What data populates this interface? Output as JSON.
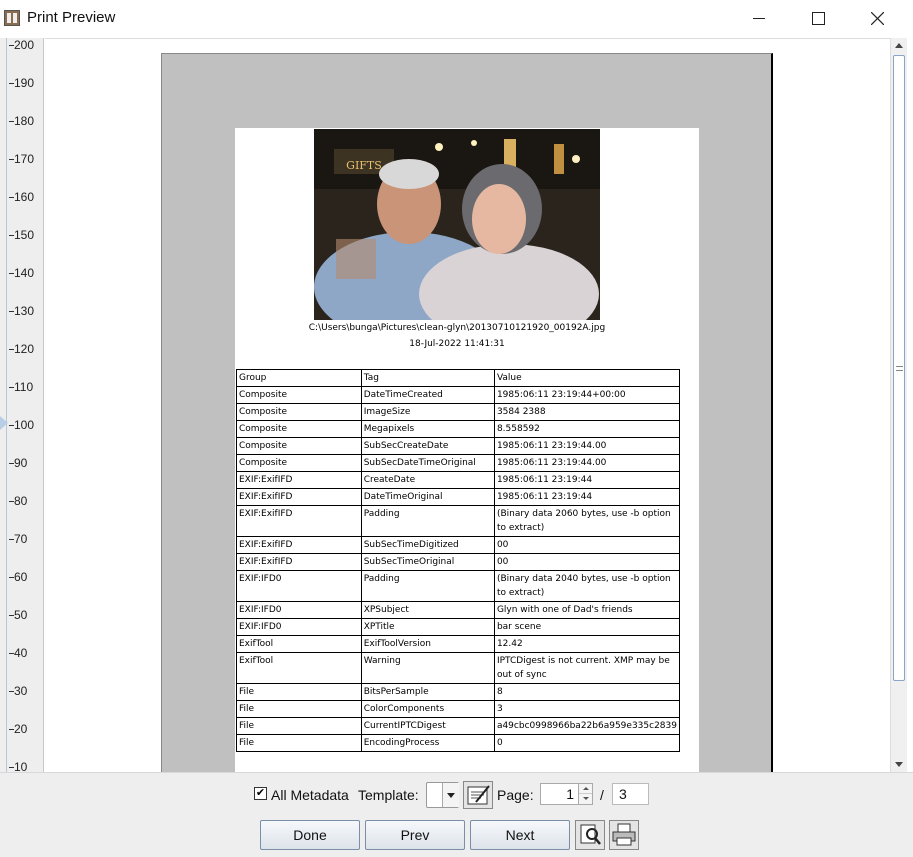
{
  "window": {
    "title": "Print Preview"
  },
  "ruler": {
    "ticks": [
      "200",
      "190",
      "180",
      "170",
      "160",
      "150",
      "140",
      "130",
      "120",
      "110",
      "100",
      "90",
      "80",
      "70",
      "60",
      "50",
      "40",
      "30",
      "20",
      "10"
    ]
  },
  "preview": {
    "file_path": "C:\\Users\\bunga\\Pictures\\clean-glyn\\20130710121920_00192A.jpg",
    "print_date": "18-Jul-2022 11:41:31",
    "photo_sign": "GIFTS",
    "table": {
      "headers": [
        "Group",
        "Tag",
        "Value"
      ],
      "rows": [
        [
          "Composite",
          "DateTimeCreated",
          "1985:06:11 23:19:44+00:00"
        ],
        [
          "Composite",
          "ImageSize",
          "3584 2388"
        ],
        [
          "Composite",
          "Megapixels",
          "8.558592"
        ],
        [
          "Composite",
          "SubSecCreateDate",
          "1985:06:11 23:19:44.00"
        ],
        [
          "Composite",
          "SubSecDateTimeOriginal",
          "1985:06:11 23:19:44.00"
        ],
        [
          "EXIF:ExifIFD",
          "CreateDate",
          "1985:06:11 23:19:44"
        ],
        [
          "EXIF:ExifIFD",
          "DateTimeOriginal",
          "1985:06:11 23:19:44"
        ],
        [
          "EXIF:ExifIFD",
          "Padding",
          "(Binary data 2060 bytes, use -b option to extract)"
        ],
        [
          "EXIF:ExifIFD",
          "SubSecTimeDigitized",
          "00"
        ],
        [
          "EXIF:ExifIFD",
          "SubSecTimeOriginal",
          "00"
        ],
        [
          "EXIF:IFD0",
          "Padding",
          "(Binary data 2040 bytes, use -b option to extract)"
        ],
        [
          "EXIF:IFD0",
          "XPSubject",
          "Glyn with one of Dad's friends"
        ],
        [
          "EXIF:IFD0",
          "XPTitle",
          "bar scene"
        ],
        [
          "ExifTool",
          "ExifToolVersion",
          "12.42"
        ],
        [
          "ExifTool",
          "Warning",
          "IPTCDigest is not current. XMP may be out of sync"
        ],
        [
          "File",
          "BitsPerSample",
          "8"
        ],
        [
          "File",
          "ColorComponents",
          "3"
        ],
        [
          "File",
          "CurrentIPTCDigest",
          "a49cbc0998966ba22b6a959e335c2839"
        ],
        [
          "File",
          "EncodingProcess",
          "0"
        ]
      ]
    }
  },
  "controls": {
    "all_metadata_label": "All Metadata",
    "all_metadata_checked": true,
    "check_mark": "✔",
    "template_label": "Template:",
    "page_label": "Page:",
    "page_value": "1",
    "page_separator": "/",
    "page_total": "3",
    "done_label": "Done",
    "prev_label": "Prev",
    "next_label": "Next",
    "icons": {
      "edit_template": "notepad-icon",
      "page_setup": "page-setup-icon",
      "print": "printer-icon"
    }
  }
}
